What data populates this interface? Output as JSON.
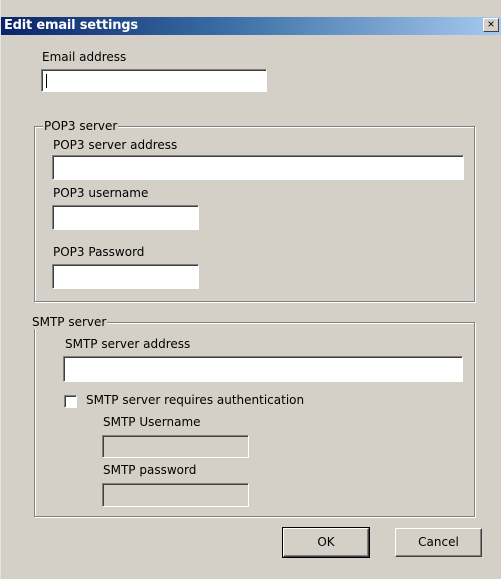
{
  "window": {
    "title": "Edit email settings",
    "close_glyph": "×"
  },
  "email": {
    "label": "Email address",
    "value": ""
  },
  "pop3": {
    "group_label": "POP3 server",
    "address_label": "POP3 server address",
    "address_value": "",
    "username_label": "POP3 username",
    "username_value": "",
    "password_label": "POP3 Password",
    "password_value": ""
  },
  "smtp": {
    "group_label": "SMTP server",
    "address_label": "SMTP server address",
    "address_value": "",
    "auth_label": "SMTP server requires authentication",
    "auth_checked": false,
    "username_label": "SMTP Username",
    "username_value": "",
    "password_label": "SMTP  password",
    "password_value": ""
  },
  "buttons": {
    "ok_label": "OK",
    "cancel_label": "Cancel"
  },
  "colors": {
    "dialog_bg": "#d4d0c8",
    "title_start": "#0a246a",
    "title_end": "#a6caf0"
  }
}
